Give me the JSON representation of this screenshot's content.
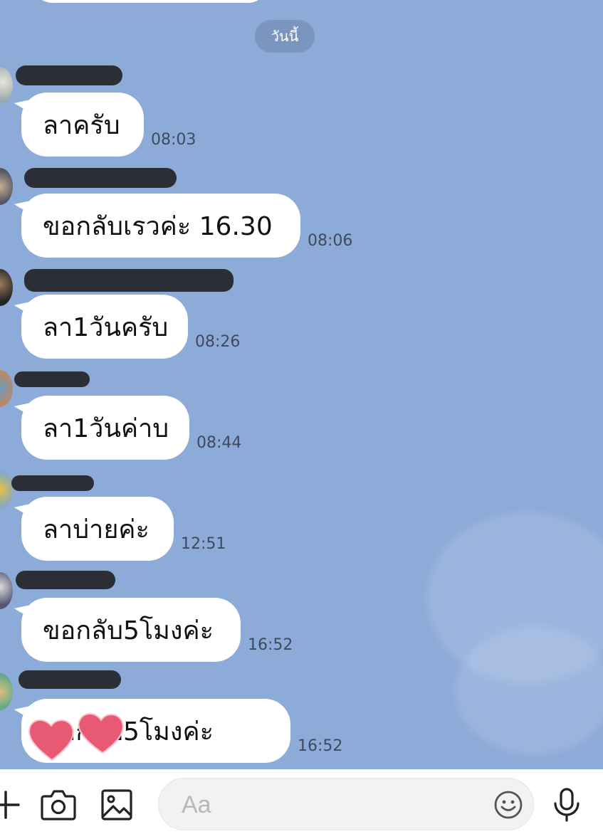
{
  "date_label": "วันนี้",
  "messages": [
    {
      "text": "ลาครับ",
      "time": "08:03"
    },
    {
      "text": "ขอกลับเรวค่ะ 16.30",
      "time": "08:06"
    },
    {
      "text": "ลา1วันครับ",
      "time": "08:26"
    },
    {
      "text": "ลา1วันค่าบ",
      "time": "08:44"
    },
    {
      "text": "ลาบ่ายค่ะ",
      "time": "12:51"
    },
    {
      "text": "ขอกลับ5โมงค่ะ",
      "time": "16:52"
    },
    {
      "text": "ขอกลับ5โมงค่ะ",
      "time": "16:52"
    }
  ],
  "input": {
    "placeholder": "Aa",
    "value": ""
  },
  "icons": {
    "plus": "plus-icon",
    "camera": "camera-icon",
    "image": "image-icon",
    "emoji": "emoji-icon",
    "mic": "microphone-icon"
  },
  "colors": {
    "chat_background": "#8dabd9",
    "bubble": "#ffffff",
    "date_pill": "#7b95bf",
    "heart": "#e85a74",
    "redaction": "#2b2e34"
  }
}
